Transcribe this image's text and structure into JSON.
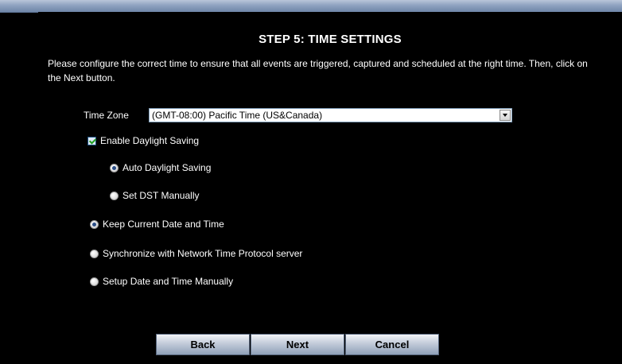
{
  "header": {
    "title": "STEP 5: TIME SETTINGS",
    "description": "Please configure the correct time to ensure that all events are triggered, captured and scheduled at the right time. Then, click on the Next button."
  },
  "time_zone": {
    "label": "Time Zone",
    "selected": "(GMT-08:00) Pacific Time (US&Canada)"
  },
  "daylight": {
    "enable_label": "Enable Daylight Saving",
    "enable_checked": true,
    "auto_label": "Auto Daylight Saving",
    "manual_label": "Set DST Manually",
    "selected": "auto"
  },
  "date_time_options": [
    {
      "label": "Keep Current Date and Time",
      "selected": true
    },
    {
      "label": "Synchronize with Network Time Protocol server",
      "selected": false
    },
    {
      "label": "Setup Date and Time Manually",
      "selected": false
    }
  ],
  "buttons": {
    "back": "Back",
    "next": "Next",
    "cancel": "Cancel"
  },
  "colors": {
    "background": "#000000",
    "topbar": "#8ea2c0",
    "text": "#ffffff"
  }
}
